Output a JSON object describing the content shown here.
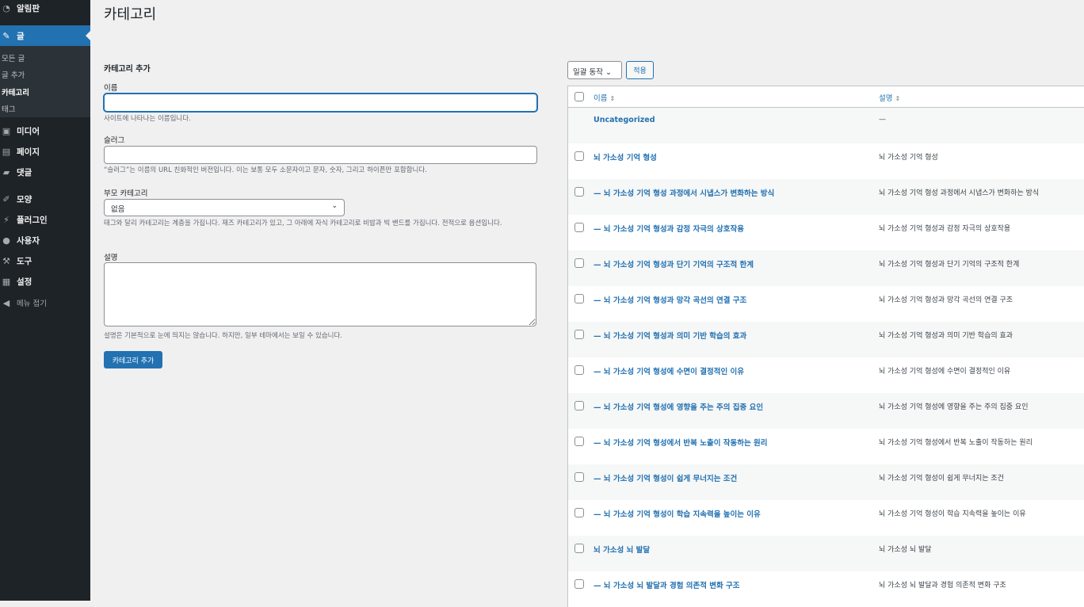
{
  "sidebar": {
    "dashboard": "알림판",
    "posts": "글",
    "all_posts": "모든 글",
    "add_post": "글 추가",
    "categories": "카테고리",
    "tags": "태그",
    "media": "미디어",
    "pages": "페이지",
    "comments": "댓글",
    "appearance": "모양",
    "plugins": "플러그인",
    "users": "사용자",
    "tools": "도구",
    "settings": "설정",
    "collapse": "메뉴 접기"
  },
  "page_title": "카테고리",
  "form": {
    "heading": "카테고리 추가",
    "name_label": "이름",
    "name_value": "",
    "name_help": "사이트에 나타나는 이름입니다.",
    "slug_label": "슬러그",
    "slug_value": "",
    "slug_help": "“슬러그”는 이름의 URL 친화적인 버전입니다. 이는 보통 모두 소문자이고 문자, 숫자, 그리고 하이픈만 포함합니다.",
    "parent_label": "부모 카테고리",
    "parent_value": "없음",
    "parent_help": "태그와 달리 카테고리는 계층을 가집니다. 재즈 카테고리가 있고, 그 아래에 자식 카테고리로 비밥과 빅 밴드를 가집니다. 전적으로 옵션입니다.",
    "desc_label": "설명",
    "desc_help": "설명은 기본적으로 눈에 띄지는 않습니다. 하지만, 일부 테마에서는 보일 수 있습니다.",
    "submit": "카테고리 추가"
  },
  "list": {
    "bulk_action": "일괄 동작",
    "apply": "적용",
    "col_name": "이름",
    "col_desc": "설명",
    "rows": [
      {
        "name": "Uncategorized",
        "desc": "—",
        "checkbox": false
      },
      {
        "name": "뇌 가소성 기억 형성",
        "desc": "뇌 가소성 기억 형성",
        "checkbox": true
      },
      {
        "name": "— 뇌 가소성 기억 형성 과정에서 시냅스가 변화하는 방식",
        "desc": "뇌 가소성 기억 형성 과정에서 시냅스가 변화하는 방식",
        "checkbox": true
      },
      {
        "name": "— 뇌 가소성 기억 형성과 감정 자극의 상호작용",
        "desc": "뇌 가소성 기억 형성과 감정 자극의 상호작용",
        "checkbox": true
      },
      {
        "name": "— 뇌 가소성 기억 형성과 단기 기억의 구조적 한계",
        "desc": "뇌 가소성 기억 형성과 단기 기억의 구조적 한계",
        "checkbox": true
      },
      {
        "name": "— 뇌 가소성 기억 형성과 망각 곡선의 연결 구조",
        "desc": "뇌 가소성 기억 형성과 망각 곡선의 연결 구조",
        "checkbox": true
      },
      {
        "name": "— 뇌 가소성 기억 형성과 의미 기반 학습의 효과",
        "desc": "뇌 가소성 기억 형성과 의미 기반 학습의 효과",
        "checkbox": true
      },
      {
        "name": "— 뇌 가소성 기억 형성에 수면이 결정적인 이유",
        "desc": "뇌 가소성 기억 형성에 수면이 결정적인 이유",
        "checkbox": true
      },
      {
        "name": "— 뇌 가소성 기억 형성에 영향을 주는 주의 집중 요인",
        "desc": "뇌 가소성 기억 형성에 영향을 주는 주의 집중 요인",
        "checkbox": true
      },
      {
        "name": "— 뇌 가소성 기억 형성에서 반복 노출이 작동하는 원리",
        "desc": "뇌 가소성 기억 형성에서 반복 노출이 작동하는 원리",
        "checkbox": true
      },
      {
        "name": "— 뇌 가소성 기억 형성이 쉽게 무너지는 조건",
        "desc": "뇌 가소성 기억 형성이 쉽게 무너지는 조건",
        "checkbox": true
      },
      {
        "name": "— 뇌 가소성 기억 형성이 학습 지속력을 높이는 이유",
        "desc": "뇌 가소성 기억 형성이 학습 지속력을 높이는 이유",
        "checkbox": true
      },
      {
        "name": "뇌 가소성 뇌 발달",
        "desc": "뇌 가소성 뇌 발달",
        "checkbox": true
      },
      {
        "name": "— 뇌 가소성 뇌 발달과 경험 의존적 변화 구조",
        "desc": "뇌 가소성 뇌 발달과 경험 의존적 변화 구조",
        "checkbox": true
      }
    ]
  }
}
